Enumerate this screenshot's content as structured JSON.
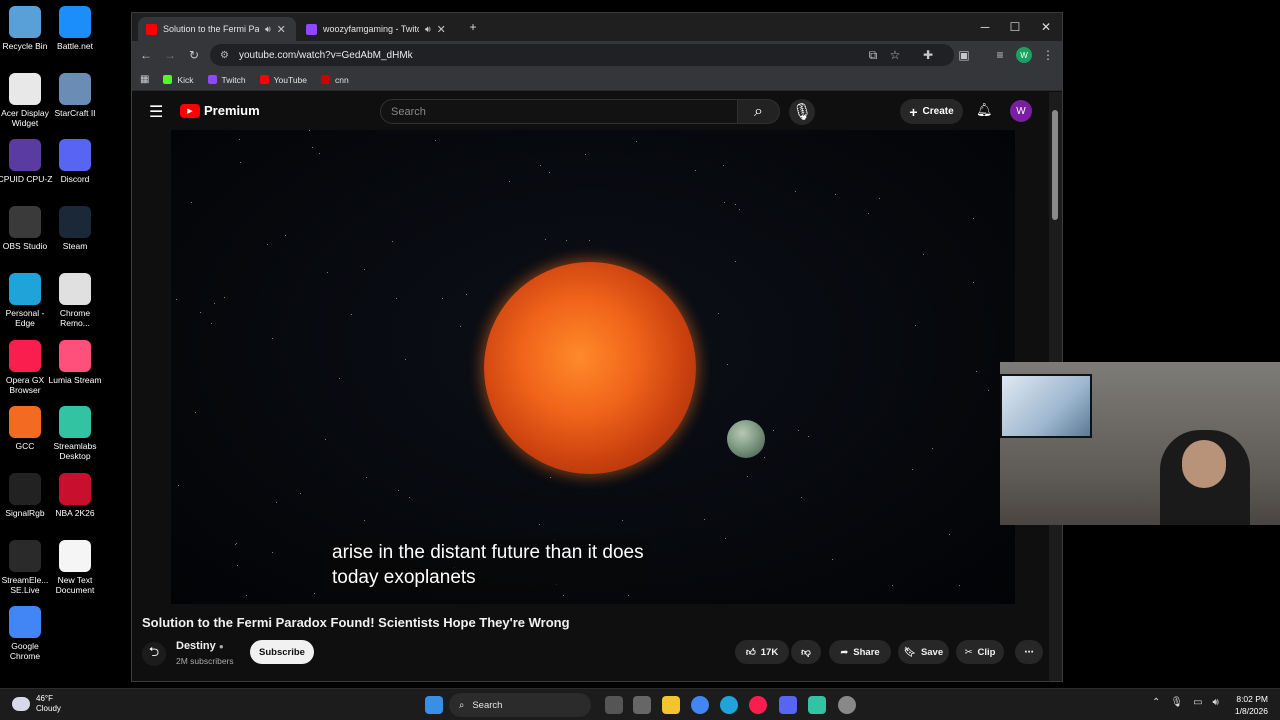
{
  "desktop": {
    "icons": [
      {
        "label": "Recycle Bin",
        "icon": "recycle-bin-icon",
        "color": "#5aa0d8"
      },
      {
        "label": "Battle.net",
        "icon": "battlenet-icon",
        "color": "#1c8ef9"
      },
      {
        "label": "Acer Display Widget",
        "icon": "acer-display-widget-icon",
        "color": "#e8e8e8"
      },
      {
        "label": "StarCraft II",
        "icon": "starcraft-icon",
        "color": "#6a8cb5"
      },
      {
        "label": "CPUID CPU-Z",
        "icon": "cpuz-icon",
        "color": "#5a3ca0"
      },
      {
        "label": "Discord",
        "icon": "discord-icon",
        "color": "#5865f2"
      },
      {
        "label": "OBS Studio",
        "icon": "obs-icon",
        "color": "#3a3a3a"
      },
      {
        "label": "Steam",
        "icon": "steam-icon",
        "color": "#1b2838"
      },
      {
        "label": "Personal - Edge",
        "icon": "edge-icon",
        "color": "#1fa3d8"
      },
      {
        "label": "Chrome Remo...",
        "icon": "chrome-remote-icon",
        "color": "#e0e0e0"
      },
      {
        "label": "Opera GX Browser",
        "icon": "opera-gx-icon",
        "color": "#fa1e4e"
      },
      {
        "label": "Lumia Stream",
        "icon": "lumia-stream-icon",
        "color": "#ff4f7a"
      },
      {
        "label": "GCC",
        "icon": "gcc-icon",
        "color": "#f26b21"
      },
      {
        "label": "Streamlabs Desktop",
        "icon": "streamlabs-icon",
        "color": "#31c3a2"
      },
      {
        "label": "SignalRgb",
        "icon": "signalrgb-icon",
        "color": "#222222"
      },
      {
        "label": "NBA 2K26",
        "icon": "nba2k-icon",
        "color": "#c8102e"
      },
      {
        "label": "StreamEle... SE.Live",
        "icon": "streamelements-icon",
        "color": "#2a2a2a"
      },
      {
        "label": "New Text Document",
        "icon": "text-document-icon",
        "color": "#f5f5f5"
      },
      {
        "label": "Google Chrome",
        "icon": "chrome-icon",
        "color": "#4285f4"
      }
    ]
  },
  "browser": {
    "tabs": [
      {
        "title": "Solution to the Fermi Parad",
        "favicon_color": "#ff0000",
        "active": true
      },
      {
        "title": "woozyfamgaming - Twitch",
        "favicon_color": "#9146ff",
        "active": false
      }
    ],
    "new_tab": "+",
    "url": "youtube.com/watch?v=GedAbM_dHMk",
    "bookmarks": [
      {
        "label": "Kick",
        "color": "#53fc18"
      },
      {
        "label": "Twitch",
        "color": "#9146ff"
      },
      {
        "label": "YouTube",
        "color": "#ff0000"
      },
      {
        "label": "cnn",
        "color": "#cc0000"
      }
    ],
    "profile_initial": "W"
  },
  "youtube": {
    "logo_text": "Premium",
    "search_placeholder": "Search",
    "create_label": "Create",
    "avatar_initial": "W",
    "caption_line1": "arise in the distant future than it does",
    "caption_line2": "today exoplanets",
    "video_title": "Solution to the Fermi Paradox Found! Scientists Hope They're Wrong",
    "channel_name": "Destiny",
    "channel_subs": "2M subscribers",
    "subscribe_label": "Subscribe",
    "likes": "17K",
    "share_label": "Share",
    "save_label": "Save",
    "clip_label": "Clip"
  },
  "taskbar": {
    "temperature": "46°F",
    "condition": "Cloudy",
    "search_label": "Search",
    "time": "8:02 PM",
    "date": "1/8/2026"
  }
}
